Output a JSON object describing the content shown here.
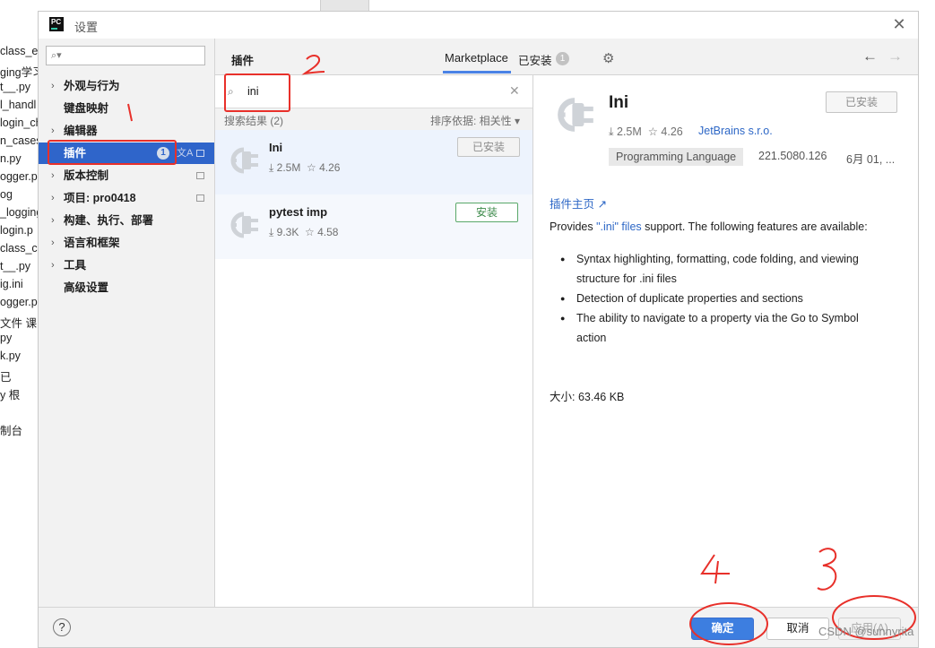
{
  "background_ide": {
    "lines": [
      "class_ex",
      "ging学习",
      "t__.py",
      "l_handl",
      "login_ch",
      "n_cases",
      "n.py",
      "ogger.p",
      "og",
      "_logging",
      "login.p",
      "class_co",
      "t__.py",
      "ig.ini",
      "ogger.p",
      "文件 课",
      "py",
      "k.py",
      "已",
      "y 根",
      "",
      "制台"
    ]
  },
  "window": {
    "title": "设置",
    "logo": "PC",
    "close_glyph": "✕"
  },
  "sidebar": {
    "search_placeholder": "",
    "items": [
      {
        "label": "外观与行为",
        "chevron": "›"
      },
      {
        "label": "键盘映射",
        "chevron": ""
      },
      {
        "label": "编辑器",
        "chevron": "›"
      },
      {
        "label": "插件",
        "chevron": "",
        "badge": "1",
        "selected": true
      },
      {
        "label": "版本控制",
        "chevron": "›"
      },
      {
        "label": "项目: pro0418",
        "chevron": "›"
      },
      {
        "label": "构建、执行、部署",
        "chevron": "›"
      },
      {
        "label": "语言和框架",
        "chevron": "›"
      },
      {
        "label": "工具",
        "chevron": "›"
      },
      {
        "label": "高级设置",
        "chevron": ""
      }
    ]
  },
  "header": {
    "breadcrumb": "插件",
    "tab_marketplace": "Marketplace",
    "tab_installed": "已安装",
    "tab_installed_badge": "1"
  },
  "plugin_search": {
    "value": "ini",
    "result_count": "搜索结果 (2)",
    "sort_by": "排序依据: 相关性 ▾"
  },
  "plugins": [
    {
      "name": "Ini",
      "downloads": "2.5M",
      "rating": "4.26",
      "button": "已安装",
      "button_state": "installed"
    },
    {
      "name": "pytest imp",
      "downloads": "9.3K",
      "rating": "4.58",
      "button": "安装",
      "button_state": "install"
    }
  ],
  "detail": {
    "name": "Ini",
    "button": "已安装",
    "downloads": "2.5M",
    "rating": "4.26",
    "vendor": "JetBrains s.r.o.",
    "tag": "Programming Language",
    "version": "221.5080.126",
    "date": "6月 01, ...",
    "homepage": "插件主页 ↗",
    "desc_prefix": "Provides ",
    "desc_highlight": "\".ini\" files",
    "desc_suffix": " support. The following features are available:",
    "bullets": [
      "Syntax highlighting, formatting, code folding, and viewing structure for .ini files",
      "Detection of duplicate properties and sections",
      "The ability to navigate to a property via the Go to Symbol action"
    ],
    "size": "大小: 63.46 KB"
  },
  "footer": {
    "help": "?",
    "ok": "确定",
    "cancel": "取消",
    "apply": "应用(A)"
  },
  "annotations": {
    "marks": [
      "1",
      "2",
      "3",
      "4"
    ],
    "color": "#e8302a"
  },
  "watermark": "CSDN @sunnyrita",
  "colors": {
    "accent": "#2f65ca",
    "link": "#2d67c6",
    "install_green": "#59a869",
    "annotation_red": "#e8302a"
  }
}
